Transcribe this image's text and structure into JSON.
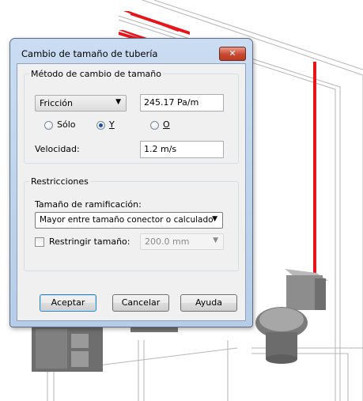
{
  "dialog": {
    "title": "Cambio de tamaño de tubería",
    "close_glyph": "✕",
    "method_group": {
      "legend": "Método de cambio de tamaño",
      "method_select": "Fricción",
      "friction_value": "245.17 Pa/m",
      "radios": [
        {
          "label": "Sólo",
          "selected": false
        },
        {
          "label": "Y",
          "selected": true
        },
        {
          "label": "O",
          "selected": false
        }
      ],
      "velocity_label": "Velocidad:",
      "velocity_value": "1.2 m/s"
    },
    "constraints_group": {
      "legend": "Restricciones",
      "branch_label": "Tamaño de ramificación:",
      "branch_select": "Mayor entre tamaño conector o calculado",
      "restrict_label": "Restringir tamaño:",
      "restrict_checked": false,
      "restrict_value": "200.0 mm"
    },
    "buttons": {
      "accept": "Aceptar",
      "cancel": "Cancelar",
      "help": "Ayuda"
    }
  },
  "colors": {
    "pipe": "#e8141b",
    "dialog_frame": "#c2d6ee",
    "default_button_border": "#3c7fb1"
  }
}
